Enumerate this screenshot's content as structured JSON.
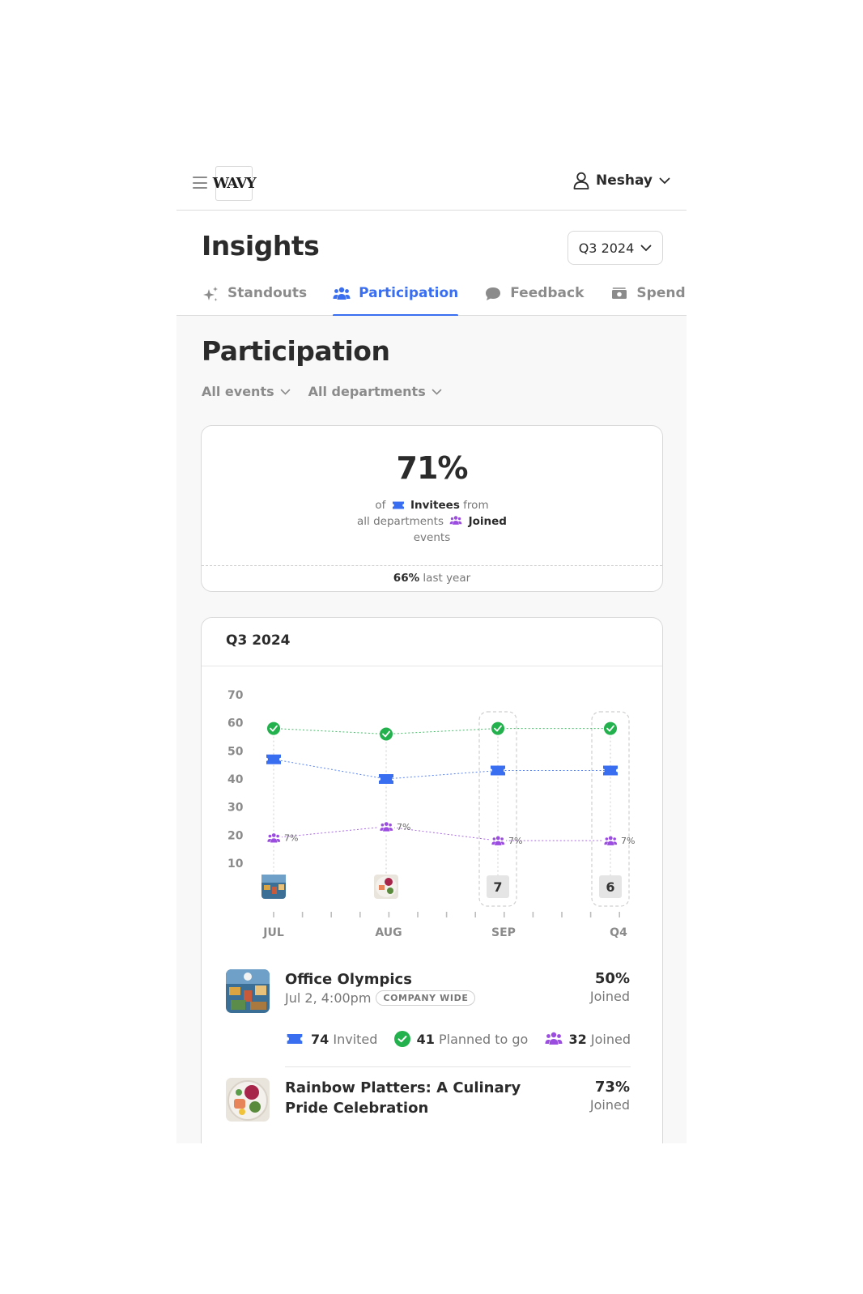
{
  "app": {
    "logo_text": "WAVY",
    "user_name": "Neshay"
  },
  "header": {
    "title": "Insights",
    "period": "Q3 2024"
  },
  "tabs": [
    {
      "label": "Standouts",
      "icon": "sparkle-icon",
      "active": false
    },
    {
      "label": "Participation",
      "icon": "people-icon",
      "active": true
    },
    {
      "label": "Feedback",
      "icon": "chat-bubble-icon",
      "active": false
    },
    {
      "label": "Spend",
      "icon": "cash-icon",
      "active": false
    }
  ],
  "section": {
    "title": "Participation",
    "filter_events": "All events",
    "filter_departments": "All departments"
  },
  "summary": {
    "percent": "71%",
    "line1_pre": "of",
    "line1_bold": "Invitees",
    "line1_post": "from",
    "line2_pre": "all departments",
    "line2_bold": "Joined",
    "line3": "events",
    "last_year_value": "66%",
    "last_year_label": "last year"
  },
  "chart_card": {
    "title": "Q3 2024"
  },
  "chart_data": {
    "type": "line",
    "y_ticks": [
      "70",
      "60",
      "50",
      "40",
      "30",
      "20",
      "10"
    ],
    "ylim": [
      0,
      70
    ],
    "categories": [
      "JUL",
      "AUG",
      "SEP",
      "Q4"
    ],
    "series": [
      {
        "name": "Planned to go",
        "icon": "check-circle-icon",
        "color": "#22b14c",
        "values": [
          58,
          56,
          58,
          58
        ]
      },
      {
        "name": "Invitees",
        "icon": "ticket-icon",
        "color": "#3a6ef0",
        "values": [
          47,
          40,
          43,
          43
        ]
      },
      {
        "name": "Joined",
        "icon": "people-icon",
        "color": "#9b4de0",
        "values": [
          19,
          23,
          18,
          18
        ],
        "labels": [
          "7%",
          "7%",
          "7%",
          "7%"
        ]
      }
    ],
    "event_markers": [
      "photo",
      "photo",
      "7",
      "6"
    ],
    "grid": false
  },
  "events": [
    {
      "title": "Office Olympics",
      "date": "Jul 2, 4:00pm",
      "badge": "COMPANY WIDE",
      "pct": "50%",
      "pct_label": "Joined",
      "invited": "74",
      "invited_label": "Invited",
      "planned": "41",
      "planned_label": "Planned to go",
      "joined": "32",
      "joined_label": "Joined"
    },
    {
      "title": "Rainbow Platters: A Culinary Pride Celebration",
      "pct": "73%",
      "pct_label": "Joined"
    }
  ],
  "colors": {
    "accent": "#3a6ef0",
    "green": "#22b14c",
    "purple": "#9b4de0"
  }
}
